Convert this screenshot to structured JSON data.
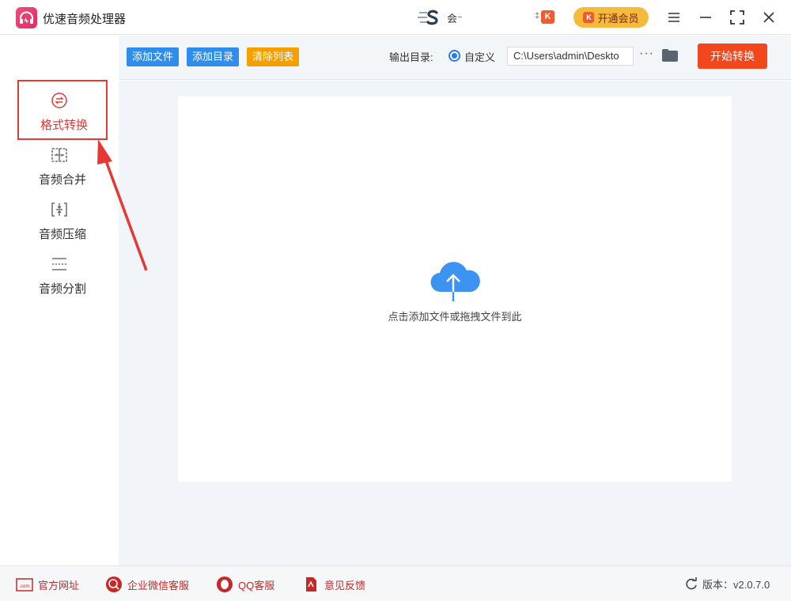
{
  "app": {
    "title": "优速音频处理器"
  },
  "user": {
    "name": "会⁻"
  },
  "header": {
    "vip_label": "开通会员",
    "k_small": "‡"
  },
  "sidebar": {
    "items": [
      {
        "label": "格式转换",
        "active": true
      },
      {
        "label": "音频合并"
      },
      {
        "label": "音频压缩"
      },
      {
        "label": "音频分割"
      }
    ]
  },
  "toolbar": {
    "add_file": "添加文件",
    "add_dir": "添加目录",
    "clear_list": "清除列表",
    "output_label": "输出目录:",
    "custom_label": "自定义",
    "output_path": "C:\\Users\\admin\\Deskto",
    "more": "···",
    "start": "开始转换"
  },
  "main": {
    "drop_hint": "点击添加文件或拖拽文件到此"
  },
  "footer": {
    "website": "官方网址",
    "wechat": "企业微信客服",
    "qq": "QQ客服",
    "feedback": "意见反馈",
    "version_label": "版本：v2.0.7.0"
  },
  "colors": {
    "accent_red": "#e53935",
    "primary_blue": "#2f7be5",
    "start_orange": "#f2461d",
    "vip_gold": "#f5b93c"
  }
}
